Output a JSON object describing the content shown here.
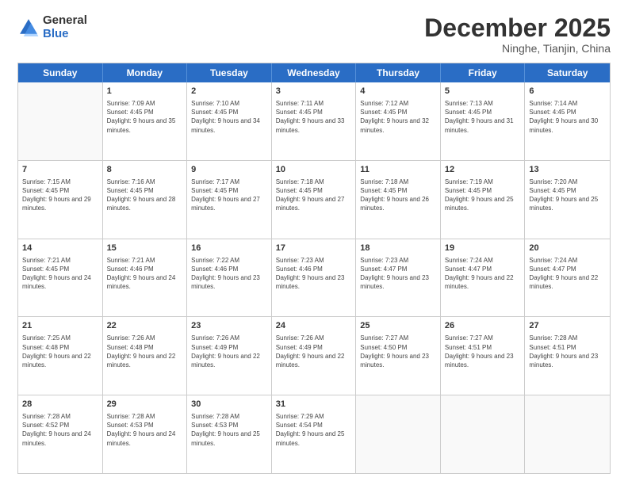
{
  "logo": {
    "general": "General",
    "blue": "Blue"
  },
  "title": {
    "main": "December 2025",
    "sub": "Ninghe, Tianjin, China"
  },
  "days": [
    "Sunday",
    "Monday",
    "Tuesday",
    "Wednesday",
    "Thursday",
    "Friday",
    "Saturday"
  ],
  "weeks": [
    [
      {
        "day": "",
        "sunrise": "",
        "sunset": "",
        "daylight": ""
      },
      {
        "day": "1",
        "sunrise": "Sunrise: 7:09 AM",
        "sunset": "Sunset: 4:45 PM",
        "daylight": "Daylight: 9 hours and 35 minutes."
      },
      {
        "day": "2",
        "sunrise": "Sunrise: 7:10 AM",
        "sunset": "Sunset: 4:45 PM",
        "daylight": "Daylight: 9 hours and 34 minutes."
      },
      {
        "day": "3",
        "sunrise": "Sunrise: 7:11 AM",
        "sunset": "Sunset: 4:45 PM",
        "daylight": "Daylight: 9 hours and 33 minutes."
      },
      {
        "day": "4",
        "sunrise": "Sunrise: 7:12 AM",
        "sunset": "Sunset: 4:45 PM",
        "daylight": "Daylight: 9 hours and 32 minutes."
      },
      {
        "day": "5",
        "sunrise": "Sunrise: 7:13 AM",
        "sunset": "Sunset: 4:45 PM",
        "daylight": "Daylight: 9 hours and 31 minutes."
      },
      {
        "day": "6",
        "sunrise": "Sunrise: 7:14 AM",
        "sunset": "Sunset: 4:45 PM",
        "daylight": "Daylight: 9 hours and 30 minutes."
      }
    ],
    [
      {
        "day": "7",
        "sunrise": "Sunrise: 7:15 AM",
        "sunset": "Sunset: 4:45 PM",
        "daylight": "Daylight: 9 hours and 29 minutes."
      },
      {
        "day": "8",
        "sunrise": "Sunrise: 7:16 AM",
        "sunset": "Sunset: 4:45 PM",
        "daylight": "Daylight: 9 hours and 28 minutes."
      },
      {
        "day": "9",
        "sunrise": "Sunrise: 7:17 AM",
        "sunset": "Sunset: 4:45 PM",
        "daylight": "Daylight: 9 hours and 27 minutes."
      },
      {
        "day": "10",
        "sunrise": "Sunrise: 7:18 AM",
        "sunset": "Sunset: 4:45 PM",
        "daylight": "Daylight: 9 hours and 27 minutes."
      },
      {
        "day": "11",
        "sunrise": "Sunrise: 7:18 AM",
        "sunset": "Sunset: 4:45 PM",
        "daylight": "Daylight: 9 hours and 26 minutes."
      },
      {
        "day": "12",
        "sunrise": "Sunrise: 7:19 AM",
        "sunset": "Sunset: 4:45 PM",
        "daylight": "Daylight: 9 hours and 25 minutes."
      },
      {
        "day": "13",
        "sunrise": "Sunrise: 7:20 AM",
        "sunset": "Sunset: 4:45 PM",
        "daylight": "Daylight: 9 hours and 25 minutes."
      }
    ],
    [
      {
        "day": "14",
        "sunrise": "Sunrise: 7:21 AM",
        "sunset": "Sunset: 4:45 PM",
        "daylight": "Daylight: 9 hours and 24 minutes."
      },
      {
        "day": "15",
        "sunrise": "Sunrise: 7:21 AM",
        "sunset": "Sunset: 4:46 PM",
        "daylight": "Daylight: 9 hours and 24 minutes."
      },
      {
        "day": "16",
        "sunrise": "Sunrise: 7:22 AM",
        "sunset": "Sunset: 4:46 PM",
        "daylight": "Daylight: 9 hours and 23 minutes."
      },
      {
        "day": "17",
        "sunrise": "Sunrise: 7:23 AM",
        "sunset": "Sunset: 4:46 PM",
        "daylight": "Daylight: 9 hours and 23 minutes."
      },
      {
        "day": "18",
        "sunrise": "Sunrise: 7:23 AM",
        "sunset": "Sunset: 4:47 PM",
        "daylight": "Daylight: 9 hours and 23 minutes."
      },
      {
        "day": "19",
        "sunrise": "Sunrise: 7:24 AM",
        "sunset": "Sunset: 4:47 PM",
        "daylight": "Daylight: 9 hours and 22 minutes."
      },
      {
        "day": "20",
        "sunrise": "Sunrise: 7:24 AM",
        "sunset": "Sunset: 4:47 PM",
        "daylight": "Daylight: 9 hours and 22 minutes."
      }
    ],
    [
      {
        "day": "21",
        "sunrise": "Sunrise: 7:25 AM",
        "sunset": "Sunset: 4:48 PM",
        "daylight": "Daylight: 9 hours and 22 minutes."
      },
      {
        "day": "22",
        "sunrise": "Sunrise: 7:26 AM",
        "sunset": "Sunset: 4:48 PM",
        "daylight": "Daylight: 9 hours and 22 minutes."
      },
      {
        "day": "23",
        "sunrise": "Sunrise: 7:26 AM",
        "sunset": "Sunset: 4:49 PM",
        "daylight": "Daylight: 9 hours and 22 minutes."
      },
      {
        "day": "24",
        "sunrise": "Sunrise: 7:26 AM",
        "sunset": "Sunset: 4:49 PM",
        "daylight": "Daylight: 9 hours and 22 minutes."
      },
      {
        "day": "25",
        "sunrise": "Sunrise: 7:27 AM",
        "sunset": "Sunset: 4:50 PM",
        "daylight": "Daylight: 9 hours and 23 minutes."
      },
      {
        "day": "26",
        "sunrise": "Sunrise: 7:27 AM",
        "sunset": "Sunset: 4:51 PM",
        "daylight": "Daylight: 9 hours and 23 minutes."
      },
      {
        "day": "27",
        "sunrise": "Sunrise: 7:28 AM",
        "sunset": "Sunset: 4:51 PM",
        "daylight": "Daylight: 9 hours and 23 minutes."
      }
    ],
    [
      {
        "day": "28",
        "sunrise": "Sunrise: 7:28 AM",
        "sunset": "Sunset: 4:52 PM",
        "daylight": "Daylight: 9 hours and 24 minutes."
      },
      {
        "day": "29",
        "sunrise": "Sunrise: 7:28 AM",
        "sunset": "Sunset: 4:53 PM",
        "daylight": "Daylight: 9 hours and 24 minutes."
      },
      {
        "day": "30",
        "sunrise": "Sunrise: 7:28 AM",
        "sunset": "Sunset: 4:53 PM",
        "daylight": "Daylight: 9 hours and 25 minutes."
      },
      {
        "day": "31",
        "sunrise": "Sunrise: 7:29 AM",
        "sunset": "Sunset: 4:54 PM",
        "daylight": "Daylight: 9 hours and 25 minutes."
      },
      {
        "day": "",
        "sunrise": "",
        "sunset": "",
        "daylight": ""
      },
      {
        "day": "",
        "sunrise": "",
        "sunset": "",
        "daylight": ""
      },
      {
        "day": "",
        "sunrise": "",
        "sunset": "",
        "daylight": ""
      }
    ]
  ]
}
